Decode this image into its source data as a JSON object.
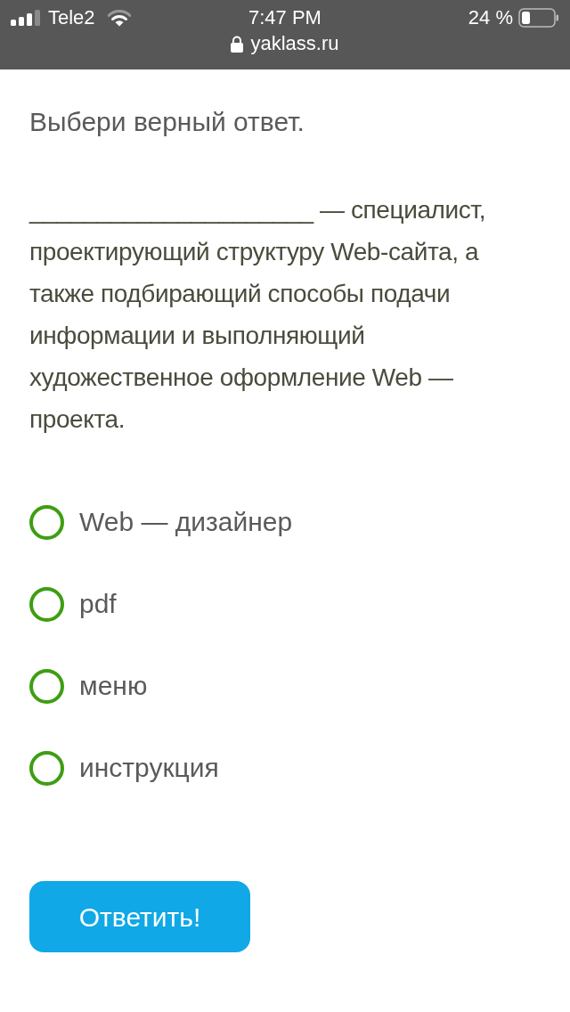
{
  "status_bar": {
    "carrier": "Tele2",
    "time": "7:47 PM",
    "battery": "24 %",
    "url": "yaklass.ru"
  },
  "instruction": "Выбери верный ответ.",
  "question": "_____________________ — специалист, проектирующий структуру Web-сайта, а также подбирающий способы подачи информации и выполняющий художественное оформление Web — проекта.",
  "options": [
    {
      "label": "Web — дизайнер",
      "selected": false
    },
    {
      "label": "pdf",
      "selected": false
    },
    {
      "label": "меню",
      "selected": false
    },
    {
      "label": "инструкция",
      "selected": false
    }
  ],
  "submit_button": "Ответить!"
}
